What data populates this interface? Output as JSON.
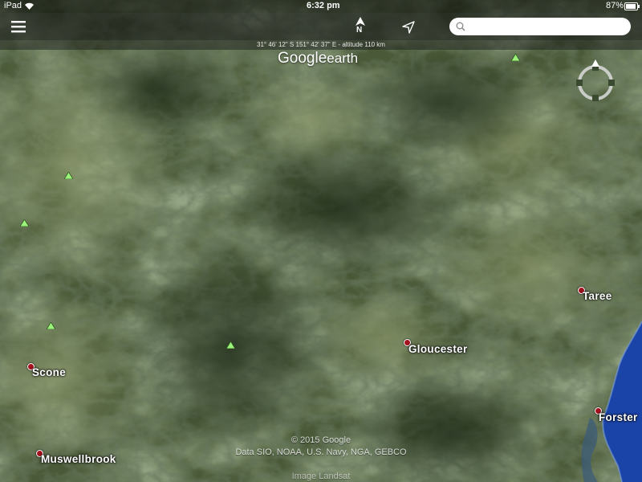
{
  "status_bar": {
    "device": "iPad",
    "time": "6:32 pm",
    "battery": "87%"
  },
  "toolbar": {
    "menu_icon": "hamburger-menu-icon",
    "north_label": "N",
    "compass_icon": "north-arrow-icon",
    "location_icon": "location-arrow-icon",
    "search_icon": "magnifier-icon",
    "search_placeholder": ""
  },
  "coordinates": "31° 46' 12\" S  151° 42' 37\" E - altitude 110 km",
  "logo": {
    "google": "Google",
    "earth": "earth"
  },
  "places": [
    {
      "name": "Taree"
    },
    {
      "name": "Gloucester"
    },
    {
      "name": "Scone"
    },
    {
      "name": "Forster"
    },
    {
      "name": "Muswellbrook"
    }
  ],
  "peaks_icon": "mountain-peak-icon",
  "attribution": {
    "copyright": "© 2015 Google",
    "data": "Data SIO, NOAA, U.S. Navy, NGA, GEBCO",
    "image": "Image Landsat"
  },
  "colors": {
    "land_dark": "#2c3a26",
    "land_mid": "#4e5e3c",
    "land_light": "#76825b",
    "ocean": "#1b44a8",
    "city_marker": "#a3121e",
    "peak_marker": "#9cf27a"
  }
}
